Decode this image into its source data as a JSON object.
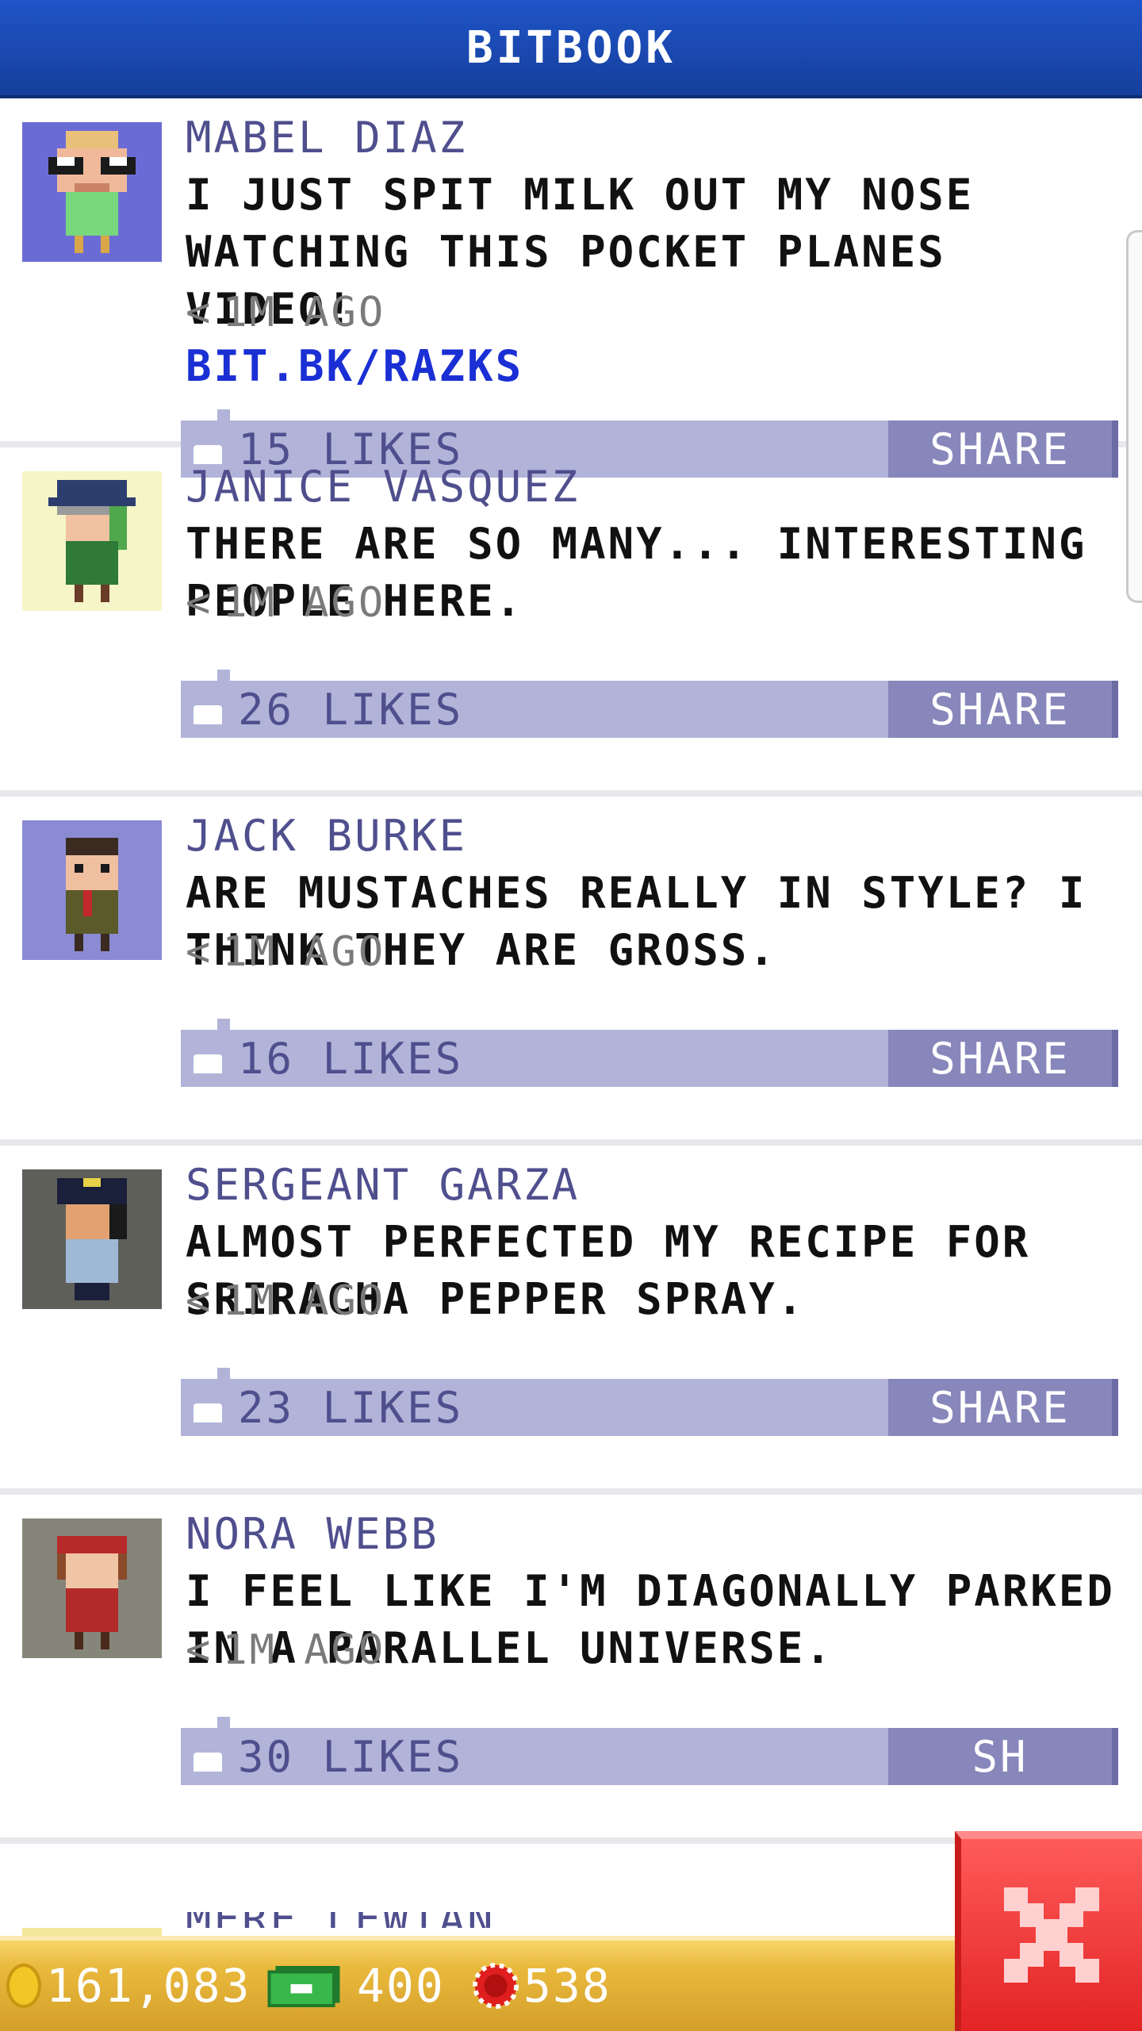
{
  "header": {
    "title": "BITBOOK"
  },
  "posts": [
    {
      "author": "MABEL DIAZ",
      "message": "I JUST SPIT MILK OUT MY NOSE WATCHING THIS POCKET PLANES VIDEO!",
      "link": "BIT.BK/RAZKS",
      "time": "1M AGO",
      "likes": "15 LIKES",
      "share": "SHARE",
      "avatar_bg": "#6b6bd6"
    },
    {
      "author": "JANICE VASQUEZ",
      "message": "THERE ARE SO MANY... INTERESTING PEOPLE HERE.",
      "time": "1M AGO",
      "likes": "26 LIKES",
      "share": "SHARE",
      "avatar_bg": "#f5f5c8"
    },
    {
      "author": "JACK BURKE",
      "message": "ARE MUSTACHES REALLY IN STYLE? I THINK THEY ARE GROSS.",
      "time": "1M AGO",
      "likes": "16 LIKES",
      "share": "SHARE",
      "avatar_bg": "#8b8bd4"
    },
    {
      "author": "SERGEANT GARZA",
      "message": "ALMOST PERFECTED MY RECIPE FOR SRIRACHA PEPPER SPRAY.",
      "time": "1M AGO",
      "likes": "23 LIKES",
      "share": "SHARE",
      "avatar_bg": "#5f5f5a"
    },
    {
      "author": "NORA WEBB",
      "message": "I FEEL LIKE I'M DIAGONALLY PARKED IN A PARALLEL UNIVERSE.",
      "time": "1M AGO",
      "likes": "30 LIKES",
      "share": "SH",
      "avatar_bg": "#85857a"
    }
  ],
  "partial_post": {
    "author": "MERE LEWIAN"
  },
  "footer": {
    "coins": "161,083",
    "bux": "400",
    "tokens": "538"
  },
  "icons": {
    "close": "close-icon",
    "coin": "coin-icon",
    "bux": "bux-icon",
    "token": "token-icon",
    "like": "like-icon",
    "time": "time-arrow-icon"
  },
  "colors": {
    "header": "#1f54c7",
    "likebar": "#b1b4d8",
    "share": "#8787bb",
    "link": "#1a2fd4",
    "close": "#e22424",
    "footer": "#e9b93c"
  }
}
